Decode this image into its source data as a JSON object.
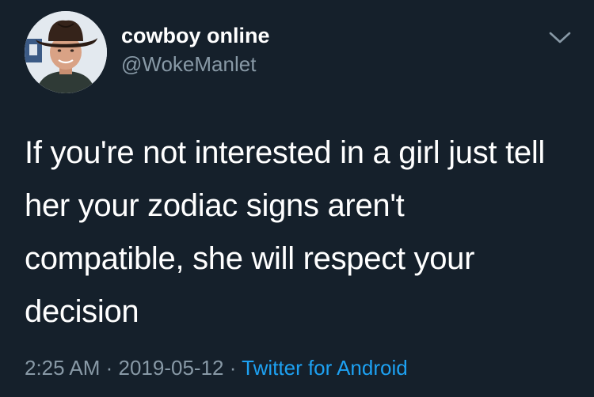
{
  "user": {
    "display_name": "cowboy online",
    "handle": "@WokeManlet",
    "avatar_icon": "profile-photo-man-in-cowboy-hat"
  },
  "tweet": {
    "text": "If you're not interested in a girl just tell her your zodiac signs aren't compatible, she will respect your decision",
    "time": "2:25 AM",
    "date": "2019-05-12",
    "separator": " · ",
    "source": "Twitter for Android"
  },
  "menu": {
    "icon": "chevron-down-icon"
  },
  "colors": {
    "background": "#15202b",
    "primary_text": "#ffffff",
    "secondary_text": "#8899a6",
    "link": "#1da1f2"
  }
}
